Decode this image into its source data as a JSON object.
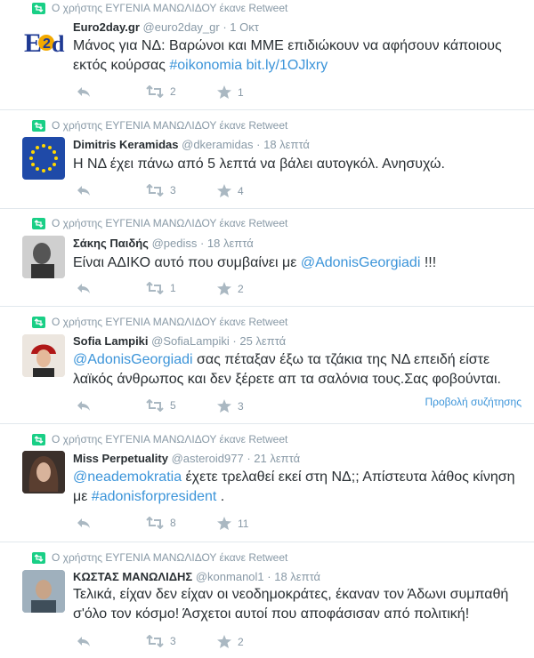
{
  "retweeter_context": "Ο χρήστης ΕΥΓΕΝΙΑ ΜΑΝΩΛΙΔΟΥ έκανε Retweet",
  "tweets": [
    {
      "name": "Euro2day.gr",
      "handle": "@euro2day_gr",
      "time": "1 Οκτ",
      "text_parts": [
        "Μάνος για ΝΔ: Βαρώνοι και ΜΜΕ επιδιώκουν να αφήσουν κάποιους εκτός κούρσας ",
        "#oikonomia",
        " ",
        "bit.ly/1OJlxry"
      ],
      "retweets": "2",
      "favorites": "1",
      "avatar_label": "E2d"
    },
    {
      "name": "Dimitris Keramidas",
      "handle": "@dkeramidas",
      "time": "18 λεπτά",
      "text_parts": [
        "Η ΝΔ έχει πάνω από 5 λεπτά να βάλει αυτογκόλ. Ανησυχώ."
      ],
      "retweets": "3",
      "favorites": "4"
    },
    {
      "name": "Σάκης Παιδής",
      "handle": "@pediss",
      "time": "18 λεπτά",
      "text_parts": [
        "Είναι ΑΔΙΚΟ αυτό που συμβαίνει με ",
        "@AdonisGeorgiadi",
        " !!!"
      ],
      "retweets": "1",
      "favorites": "2"
    },
    {
      "name": "Sofia Lampiki",
      "handle": "@SofiaLampiki",
      "time": "25 λεπτά",
      "text_parts": [
        "@AdonisGeorgiadi",
        " σας πέταξαν έξω τα τζάκια της ΝΔ επειδή είστε λαϊκός άνθρωπος και δεν ξέρετε απ τα σαλόνια τους.Σας φοβούνται."
      ],
      "retweets": "5",
      "favorites": "3",
      "conversation": "Προβολή συζήτησης"
    },
    {
      "name": "Miss Perpetuality",
      "handle": "@asteroid977",
      "time": "21 λεπτά",
      "text_parts": [
        "@neademokratia",
        " έχετε τρελαθεί εκεί στη ΝΔ;; Απίστευτα λάθος κίνηση με ",
        "#adonisforpresident",
        " ."
      ],
      "retweets": "8",
      "favorites": "11"
    },
    {
      "name": "ΚΩΣΤΑΣ ΜΑΝΩΛΙΔΗΣ",
      "handle": "@konmanol1",
      "time": "18 λεπτά",
      "text_parts": [
        "Τελικά, είχαν δεν είχαν οι νεοδημοκράτες, έκαναν τον Άδωνι συμπαθή σ'όλο τον κόσμο! Άσχετοι αυτοί που αποφάσισαν από πολιτική!"
      ],
      "retweets": "3",
      "favorites": "2"
    }
  ],
  "colors": {
    "text": "#292f33",
    "muted": "#8899a6",
    "link": "#3b94d9",
    "retweet_green": "#19cf86",
    "border": "#e1e8ed",
    "favorite_fill": "#aab8c2"
  }
}
